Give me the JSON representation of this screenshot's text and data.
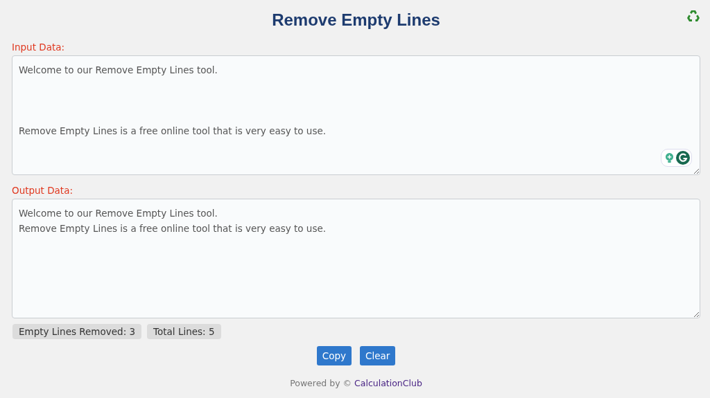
{
  "title": "Remove Empty Lines",
  "input": {
    "label": "Input Data:",
    "value": "Welcome to our Remove Empty Lines tool.\n\n\n\nRemove Empty Lines is a free online tool that is very easy to use."
  },
  "output": {
    "label": "Output Data:",
    "value": "Welcome to our Remove Empty Lines tool.\nRemove Empty Lines is a free online tool that is very easy to use."
  },
  "stats": [
    "Empty Lines Removed: 3",
    "Total Lines: 5"
  ],
  "buttons": [
    "Copy",
    "Clear"
  ],
  "footer": {
    "text": "Powered by ©",
    "link": "CalculationClub"
  }
}
